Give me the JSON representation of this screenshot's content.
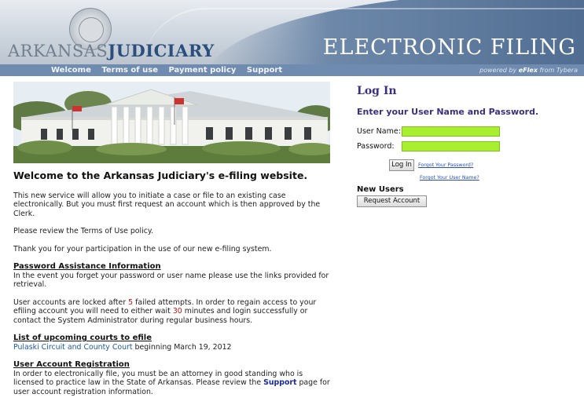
{
  "header": {
    "logo_part1": "ARKANSAS",
    "logo_part2": "JUDICIARY",
    "banner_title": "ELECTRONIC FILING"
  },
  "nav": {
    "items": [
      "Welcome",
      "Terms of use",
      "Payment policy",
      "Support"
    ],
    "powered_prefix": "powered by ",
    "powered_brand": "eFlex",
    "powered_suffix": " from Tybera"
  },
  "main": {
    "welcome_heading": "Welcome to the Arkansas Judiciary's e-filing website.",
    "intro": "This new service will allow you to initiate a case or file to an existing case electronically. But you must first request an account which is then approved by the Clerk.",
    "review": "Please review the Terms of Use policy.",
    "thanks": "Thank you for your participation in the use of our new e-filing system.",
    "password_heading": "Password Assistance Information",
    "password_text": "In the event you forget your password or user name please use the links provided for retrieval.",
    "lock_text_1": "User accounts are locked after ",
    "lock_attempts": "5",
    "lock_text_2": " failed attempts. In order to regain access to your efiling account you will need to either wait ",
    "lock_minutes": "30",
    "lock_text_3": " minutes and login successfully or contact the System Administrator during regular business hours.",
    "courts_heading": "List of upcoming courts to efile",
    "court_name": "Pulaski Circuit and County Court",
    "court_date": " beginning March 19, 2012",
    "registration_heading": "User Account Registration",
    "registration_text_1": "In order to electronically file, you must be an attorney in good standing who is licensed to practice law in the State of Arkansas. Please review the ",
    "registration_link": "Support",
    "registration_text_2": " page for user account registration information."
  },
  "login": {
    "title": "Log In",
    "subtitle": "Enter your User Name and Password.",
    "username_label": "User Name:",
    "username_value": "",
    "password_label": "Password:",
    "password_value": "",
    "login_button": "Log In",
    "forgot_password": "Forgot Your Password?",
    "forgot_username": "Forgot Your User Name?",
    "new_users_heading": "New Users",
    "request_button": "Request Account"
  },
  "colors": {
    "nav_bg": "#6f8cb0",
    "title_purple": "#3b2f7f",
    "input_green": "#a7ef2f",
    "alert_red": "#c01010"
  }
}
